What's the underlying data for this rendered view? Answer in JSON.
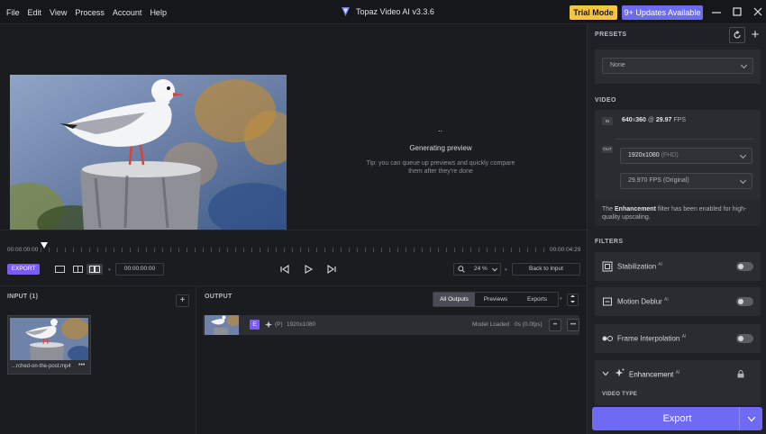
{
  "menu": [
    "File",
    "Edit",
    "View",
    "Process",
    "Account",
    "Help"
  ],
  "app": {
    "title": "Topaz Video AI  v3.3.6",
    "trial_label": "Trial Mode",
    "updates_label": "9+ Updates Available",
    "window_controls": [
      "minimize-icon",
      "maximize-icon",
      "close-icon"
    ]
  },
  "preview": {
    "loading": "..",
    "status": "Generating preview",
    "tip": "Tip: you can queue up previews and quickly compare them after they're done"
  },
  "timeline": {
    "start_time": "00:00:00:00",
    "end_time": "00:00:04:29",
    "export_label": "EXPORT",
    "current_time": "00:00:00:00",
    "zoom": "24 %",
    "back_to_input": "Back to Input"
  },
  "input": {
    "title": "INPUT (1)",
    "file_name": "...rched-on-the-post.mp4",
    "more": "•••"
  },
  "output": {
    "title": "OUTPUT",
    "tabs": [
      "All Outputs",
      "Previews",
      "Exports"
    ],
    "active_tab": "All Outputs",
    "row": {
      "badge": "E",
      "model": "(P)",
      "resolution": "1920x1080",
      "status": "Model Loaded",
      "progress": "0s (0.0fps)",
      "stop": "••",
      "more": "•••"
    }
  },
  "side": {
    "presets_title": "PRESETS",
    "preset_value": "None",
    "video_title": "VIDEO",
    "in_tag": "IN",
    "input_res_w": "640",
    "input_res_h": "360",
    "input_at": "@",
    "input_fps": "29.97",
    "input_fps_unit": "FPS",
    "out_tag": "OUT",
    "output_res": "1920x1080",
    "output_res_note": "(FHD)",
    "output_fps": "29.970 FPS (Original)",
    "note_pre": "The ",
    "note_bold": "Enhancement",
    "note_post": " filter has been enabled for high-quality upscaling.",
    "filters_title": "FILTERS",
    "filters": [
      {
        "label": "Stabilization",
        "ai": "AI"
      },
      {
        "label": "Motion Deblur",
        "ai": "AI"
      },
      {
        "label": "Frame Interpolation",
        "ai": "AI"
      }
    ],
    "enhancement_label": "Enhancement",
    "enhancement_ai": "AI",
    "video_type_label": "VIDEO TYPE",
    "export_label": "Export"
  },
  "colors": {
    "accent": "#6e6bf2",
    "trial": "#f5c542",
    "badge": "#7b5cf0"
  }
}
